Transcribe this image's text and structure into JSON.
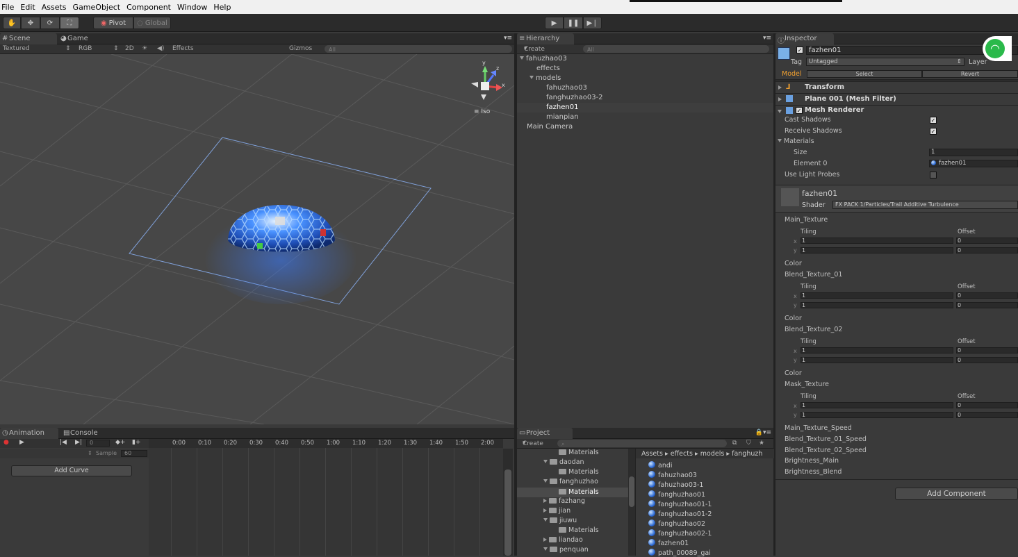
{
  "menu": [
    "File",
    "Edit",
    "Assets",
    "GameObject",
    "Component",
    "Window",
    "Help"
  ],
  "toolbar": {
    "pivot": "Pivot",
    "global": "Global"
  },
  "scene_tabs": {
    "scene": "Scene",
    "game": "Game"
  },
  "scene_bar": {
    "textured": "Textured",
    "rgb": "RGB",
    "mode2d": "2D",
    "effects": "Effects",
    "gizmos": "Gizmos",
    "search_all": "All",
    "iso": "Iso"
  },
  "gizmo_axes": {
    "y": "y",
    "x": "x",
    "z": "z"
  },
  "hierarchy": {
    "title": "Hierarchy",
    "create": "Create",
    "search": "All",
    "items": [
      {
        "label": "fahuzhao03"
      },
      {
        "label": "effects"
      },
      {
        "label": "models"
      },
      {
        "label": "fahuzhao03"
      },
      {
        "label": "fanghuzhao03-2"
      },
      {
        "label": "fazhen01"
      },
      {
        "label": "mianpian"
      },
      {
        "label": "Main Camera"
      }
    ]
  },
  "inspector": {
    "title": "Inspector",
    "object_name": "fazhen01",
    "tag_label": "Tag",
    "tag_value": "Untagged",
    "layer_label": "Layer",
    "model_label": "Model",
    "select": "Select",
    "revert": "Revert",
    "transform": "Transform",
    "mesh_filter": "Plane 001 (Mesh Filter)",
    "mesh_renderer": "Mesh Renderer",
    "cast_shadows": "Cast Shadows",
    "receive_shadows": "Receive Shadows",
    "materials": "Materials",
    "size": "Size",
    "size_value": "1",
    "element0": "Element 0",
    "element0_value": "fazhen01",
    "light_probes": "Use Light Probes",
    "material_name": "fazhen01",
    "shader_label": "Shader",
    "shader_value": "FX PACK 1/Particles/Trail Additive Turbulence",
    "tex_blocks": [
      {
        "name": "Main_Texture",
        "color": "Color"
      },
      {
        "name": "Blend_Texture_01",
        "color": "Color"
      },
      {
        "name": "Blend_Texture_02",
        "color": "Color"
      },
      {
        "name": "Mask_Texture",
        "color": ""
      }
    ],
    "tiling": "Tiling",
    "offset": "Offset",
    "x": "x",
    "y": "y",
    "one": "1",
    "zero": "0",
    "speeds": [
      "Main_Texture_Speed",
      "Blend_Texture_01_Speed",
      "Blend_Texture_02_Speed",
      "Brightness_Main",
      "Brightness_Blend"
    ],
    "add_component": "Add Component"
  },
  "animation": {
    "tab": "Animation",
    "console": "Console",
    "frame": "0",
    "sample": "Sample",
    "sample_value": "60",
    "add_curve": "Add Curve",
    "ticks": [
      "0:00",
      "0:10",
      "0:20",
      "0:30",
      "0:40",
      "0:50",
      "1:00",
      "1:10",
      "1:20",
      "1:30",
      "1:40",
      "1:50",
      "2:00"
    ]
  },
  "project": {
    "tab": "Project",
    "create": "Create",
    "breadcrumb": [
      "Assets",
      "effects",
      "models",
      "fanghuzh"
    ],
    "tree": [
      {
        "label": "Materials",
        "kind": "folder"
      },
      {
        "label": "daodan",
        "kind": "open"
      },
      {
        "label": "Materials",
        "kind": "folder"
      },
      {
        "label": "fanghuzhao",
        "kind": "open"
      },
      {
        "label": "Materials",
        "kind": "selected"
      },
      {
        "label": "fazhang",
        "kind": "closed"
      },
      {
        "label": "jian",
        "kind": "closed"
      },
      {
        "label": "jiuwu",
        "kind": "open"
      },
      {
        "label": "Materials",
        "kind": "folder"
      },
      {
        "label": "liandao",
        "kind": "closed"
      },
      {
        "label": "penquan",
        "kind": "open"
      }
    ],
    "assets": [
      "andi",
      "fahuzhao03",
      "fahuzhao03-1",
      "fanghuzhao01",
      "fanghuzhao01-1",
      "fanghuzhao01-2",
      "fanghuzhao02",
      "fanghuzhao02-1",
      "fazhen01",
      "path_00089_gai"
    ]
  },
  "colors": {
    "accent": "#3b73d6",
    "model_orange": "#f0a030",
    "wifi_green": "#2ab94a"
  }
}
